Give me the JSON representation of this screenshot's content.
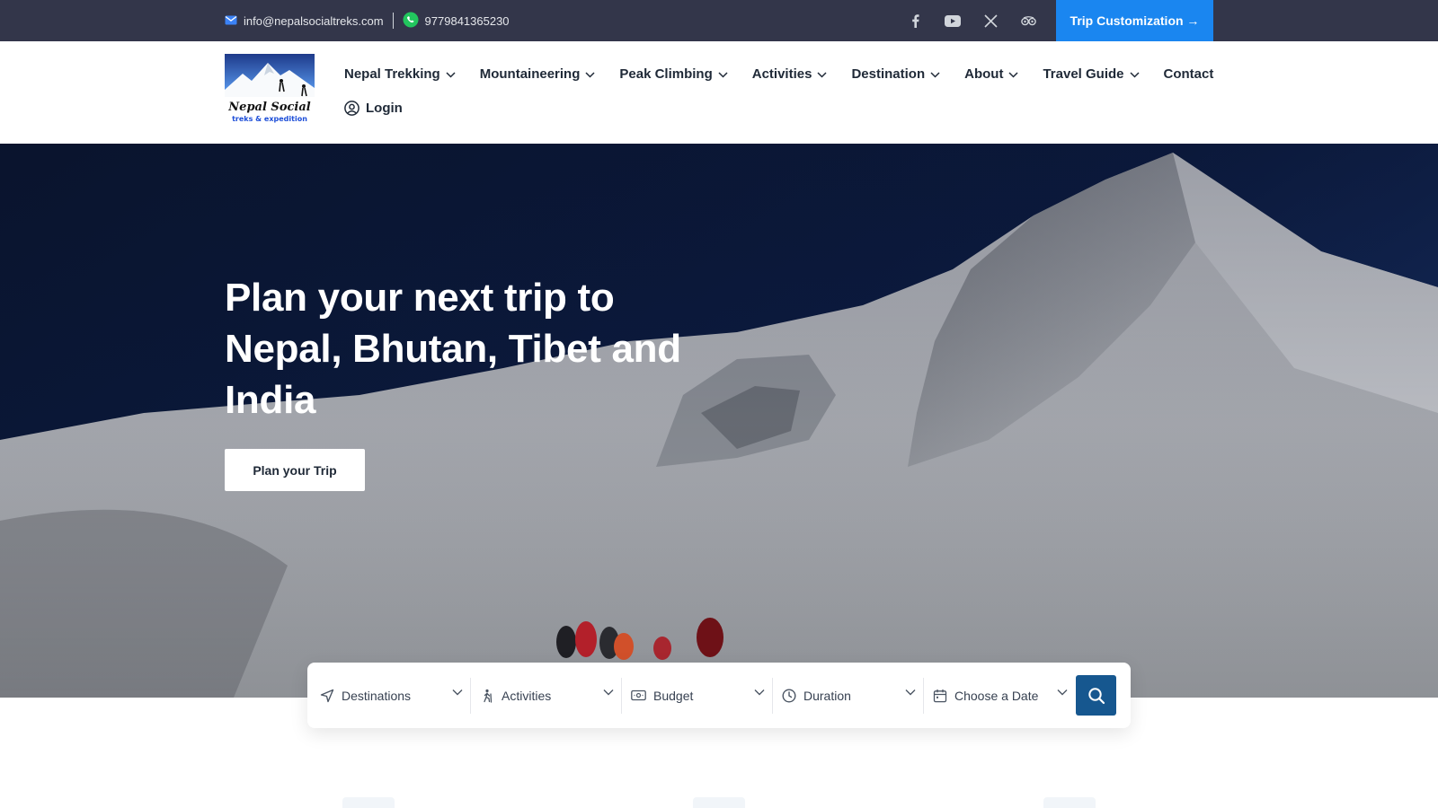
{
  "topbar": {
    "email": "info@nepalsocialtreks.com",
    "phone": "9779841365230",
    "socials": [
      "facebook-icon",
      "youtube-icon",
      "x-icon",
      "tripadvisor-icon"
    ],
    "cta_label": "Trip Customization →",
    "background": "#33364a",
    "cta_color": "#1a86f0"
  },
  "logo": {
    "name": "Nepal Social",
    "tagline": "treks & expedition"
  },
  "nav": {
    "items": [
      {
        "label": "Nepal Trekking",
        "dropdown": true
      },
      {
        "label": "Mountaineering",
        "dropdown": true
      },
      {
        "label": "Peak Climbing",
        "dropdown": true
      },
      {
        "label": "Activities",
        "dropdown": true
      },
      {
        "label": "Destination",
        "dropdown": true
      },
      {
        "label": "About",
        "dropdown": true
      },
      {
        "label": "Travel Guide",
        "dropdown": true
      },
      {
        "label": "Contact",
        "dropdown": false
      }
    ],
    "login_label": "Login"
  },
  "hero": {
    "title": "Plan your next trip to Nepal, Bhutan, Tibet and India",
    "button_label": "Plan your Trip"
  },
  "search": {
    "fields": [
      {
        "label": "Destinations",
        "icon": "navigation-arrow-icon"
      },
      {
        "label": "Activities",
        "icon": "hiker-icon"
      },
      {
        "label": "Budget",
        "icon": "banknote-icon"
      },
      {
        "label": "Duration",
        "icon": "clock-icon"
      },
      {
        "label": "Choose a Date",
        "icon": "calendar-icon"
      }
    ],
    "button_color": "#16578f"
  }
}
